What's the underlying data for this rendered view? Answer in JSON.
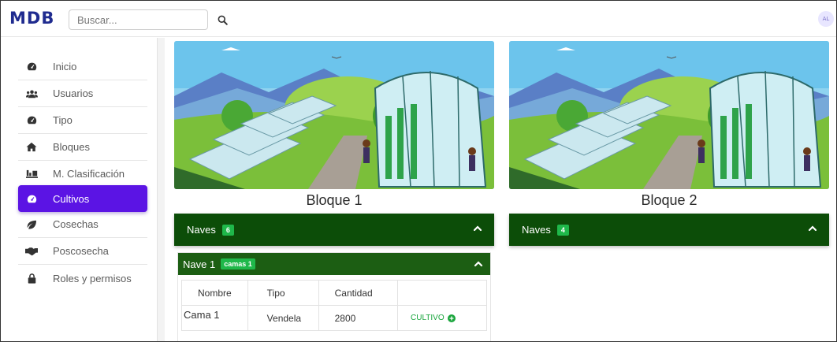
{
  "app": {
    "logo": "MDB",
    "avatar_initials": "AL"
  },
  "search": {
    "placeholder": "Buscar..."
  },
  "sidebar": {
    "items": [
      {
        "label": "Inicio",
        "icon": "dashboard-icon",
        "active": false
      },
      {
        "label": "Usuarios",
        "icon": "users-icon",
        "active": false
      },
      {
        "label": "Tipo",
        "icon": "dashboard-icon",
        "active": false
      },
      {
        "label": "Bloques",
        "icon": "home-icon",
        "active": false
      },
      {
        "label": "M. Clasificación",
        "icon": "scale-icon",
        "active": false
      },
      {
        "label": "Cultivos",
        "icon": "dashboard-icon",
        "active": true
      },
      {
        "label": "Cosechas",
        "icon": "leaf-icon",
        "active": false
      },
      {
        "label": "Poscosecha",
        "icon": "handshake-icon",
        "active": false
      },
      {
        "label": "Roles y permisos",
        "icon": "lock-icon",
        "active": false
      }
    ]
  },
  "blocks": [
    {
      "title": "Bloque 1",
      "naves_label": "Naves",
      "naves_count": "6",
      "expanded": true,
      "nave": {
        "label": "Nave 1",
        "camas_badge": "camas 1",
        "table": {
          "headers": [
            "Nombre",
            "Tipo",
            "Cantidad",
            ""
          ],
          "rows": [
            {
              "nombre": "Cama 1",
              "tipo": "Vendela",
              "cantidad": "2800",
              "action": "CULTIVO"
            }
          ]
        }
      }
    },
    {
      "title": "Bloque 2",
      "naves_label": "Naves",
      "naves_count": "4",
      "expanded": false
    }
  ],
  "colors": {
    "accent": "#5b14e4",
    "naves_bar": "#0c4d08",
    "nave_bar": "#1c5e13",
    "badge_green": "#1fb84a"
  }
}
